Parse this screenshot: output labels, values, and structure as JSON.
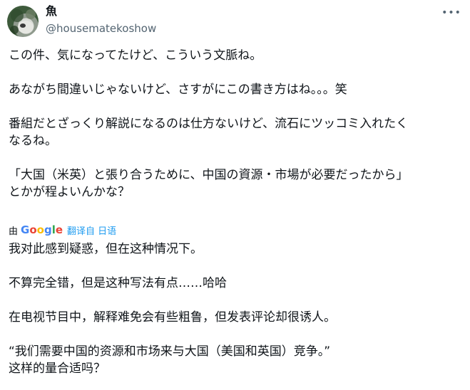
{
  "author": {
    "display_name": "魚",
    "handle": "@housematekoshow"
  },
  "menu": {
    "more_label": "•••"
  },
  "tweet": {
    "text": "この件、気になってたけど、こういう文脈ね。\n\nあながち間違いじゃないけど、さすがにこの書き方はね。。。笑\n\n番組だとざっくり解説になるのは仕方ないけど、流石にツッコミ入れたく\nなるね。\n\n「大国（米英）と張り合うために、中国の資源・市場が必要だったから」\nとかが程よいんかな？"
  },
  "translation": {
    "by_label": "由",
    "google_label": "Google",
    "translated_from": "翻译自 日语",
    "text": "我对此感到疑惑，但在这种情况下。\n\n不算完全错，但是这种写法有点……哈哈\n\n在电视节目中，解释难免会有些粗鲁，但发表评论却很诱人。\n\n“我们需要中国的资源和市场来与大国（美国和英国）竞争。”\n这样的量合适吗？"
  },
  "colors": {
    "text": "#0f1419",
    "secondary": "#536471",
    "link": "#1d9bf0"
  }
}
